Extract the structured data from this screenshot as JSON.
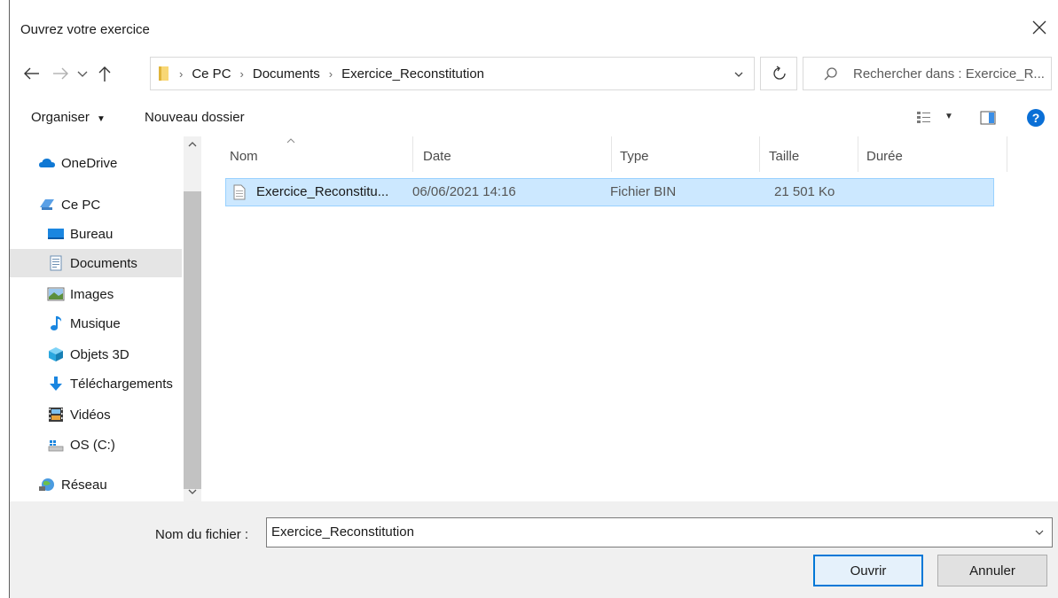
{
  "window": {
    "title": "Ouvrez votre exercice"
  },
  "address": {
    "crumbs": [
      "Ce PC",
      "Documents",
      "Exercice_Reconstitution"
    ],
    "search_placeholder": "Rechercher dans : Exercice_R..."
  },
  "toolbar": {
    "organize_label": "Organiser",
    "new_folder_label": "Nouveau dossier"
  },
  "sidebar": {
    "items": [
      {
        "label": "OneDrive",
        "icon": "cloud-icon"
      },
      {
        "label": "Ce PC",
        "icon": "computer-icon"
      },
      {
        "label": "Bureau",
        "icon": "desktop-icon"
      },
      {
        "label": "Documents",
        "icon": "documents-icon",
        "selected": true
      },
      {
        "label": "Images",
        "icon": "images-icon"
      },
      {
        "label": "Musique",
        "icon": "music-icon"
      },
      {
        "label": "Objets 3D",
        "icon": "cube-icon"
      },
      {
        "label": "Téléchargements",
        "icon": "download-icon"
      },
      {
        "label": "Vidéos",
        "icon": "video-icon"
      },
      {
        "label": "OS (C:)",
        "icon": "drive-icon"
      },
      {
        "label": "Réseau",
        "icon": "network-icon"
      }
    ]
  },
  "filelist": {
    "columns": [
      "Nom",
      "Date",
      "Type",
      "Taille",
      "Durée"
    ],
    "rows": [
      {
        "name": "Exercice_Reconstitu...",
        "date": "06/06/2021 14:16",
        "type": "Fichier BIN",
        "size": "21 501 Ko",
        "duration": ""
      }
    ]
  },
  "footer": {
    "filename_label": "Nom du fichier :",
    "filename_value": "Exercice_Reconstitution",
    "open_label": "Ouvrir",
    "cancel_label": "Annuler"
  },
  "colors": {
    "selection": "#cce8ff",
    "selection_border": "#99d1ff",
    "accent": "#0078d7",
    "folder": "#f8d775"
  }
}
